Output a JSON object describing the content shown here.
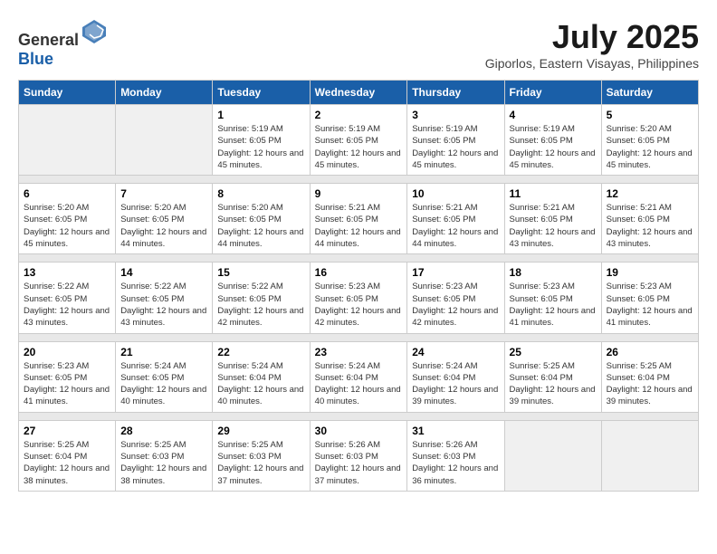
{
  "header": {
    "logo_general": "General",
    "logo_blue": "Blue",
    "month_year": "July 2025",
    "location": "Giporlos, Eastern Visayas, Philippines"
  },
  "calendar": {
    "days_of_week": [
      "Sunday",
      "Monday",
      "Tuesday",
      "Wednesday",
      "Thursday",
      "Friday",
      "Saturday"
    ],
    "weeks": [
      [
        {
          "day": "",
          "sunrise": "",
          "sunset": "",
          "daylight": ""
        },
        {
          "day": "",
          "sunrise": "",
          "sunset": "",
          "daylight": ""
        },
        {
          "day": "1",
          "sunrise": "Sunrise: 5:19 AM",
          "sunset": "Sunset: 6:05 PM",
          "daylight": "Daylight: 12 hours and 45 minutes."
        },
        {
          "day": "2",
          "sunrise": "Sunrise: 5:19 AM",
          "sunset": "Sunset: 6:05 PM",
          "daylight": "Daylight: 12 hours and 45 minutes."
        },
        {
          "day": "3",
          "sunrise": "Sunrise: 5:19 AM",
          "sunset": "Sunset: 6:05 PM",
          "daylight": "Daylight: 12 hours and 45 minutes."
        },
        {
          "day": "4",
          "sunrise": "Sunrise: 5:19 AM",
          "sunset": "Sunset: 6:05 PM",
          "daylight": "Daylight: 12 hours and 45 minutes."
        },
        {
          "day": "5",
          "sunrise": "Sunrise: 5:20 AM",
          "sunset": "Sunset: 6:05 PM",
          "daylight": "Daylight: 12 hours and 45 minutes."
        }
      ],
      [
        {
          "day": "6",
          "sunrise": "Sunrise: 5:20 AM",
          "sunset": "Sunset: 6:05 PM",
          "daylight": "Daylight: 12 hours and 45 minutes."
        },
        {
          "day": "7",
          "sunrise": "Sunrise: 5:20 AM",
          "sunset": "Sunset: 6:05 PM",
          "daylight": "Daylight: 12 hours and 44 minutes."
        },
        {
          "day": "8",
          "sunrise": "Sunrise: 5:20 AM",
          "sunset": "Sunset: 6:05 PM",
          "daylight": "Daylight: 12 hours and 44 minutes."
        },
        {
          "day": "9",
          "sunrise": "Sunrise: 5:21 AM",
          "sunset": "Sunset: 6:05 PM",
          "daylight": "Daylight: 12 hours and 44 minutes."
        },
        {
          "day": "10",
          "sunrise": "Sunrise: 5:21 AM",
          "sunset": "Sunset: 6:05 PM",
          "daylight": "Daylight: 12 hours and 44 minutes."
        },
        {
          "day": "11",
          "sunrise": "Sunrise: 5:21 AM",
          "sunset": "Sunset: 6:05 PM",
          "daylight": "Daylight: 12 hours and 43 minutes."
        },
        {
          "day": "12",
          "sunrise": "Sunrise: 5:21 AM",
          "sunset": "Sunset: 6:05 PM",
          "daylight": "Daylight: 12 hours and 43 minutes."
        }
      ],
      [
        {
          "day": "13",
          "sunrise": "Sunrise: 5:22 AM",
          "sunset": "Sunset: 6:05 PM",
          "daylight": "Daylight: 12 hours and 43 minutes."
        },
        {
          "day": "14",
          "sunrise": "Sunrise: 5:22 AM",
          "sunset": "Sunset: 6:05 PM",
          "daylight": "Daylight: 12 hours and 43 minutes."
        },
        {
          "day": "15",
          "sunrise": "Sunrise: 5:22 AM",
          "sunset": "Sunset: 6:05 PM",
          "daylight": "Daylight: 12 hours and 42 minutes."
        },
        {
          "day": "16",
          "sunrise": "Sunrise: 5:23 AM",
          "sunset": "Sunset: 6:05 PM",
          "daylight": "Daylight: 12 hours and 42 minutes."
        },
        {
          "day": "17",
          "sunrise": "Sunrise: 5:23 AM",
          "sunset": "Sunset: 6:05 PM",
          "daylight": "Daylight: 12 hours and 42 minutes."
        },
        {
          "day": "18",
          "sunrise": "Sunrise: 5:23 AM",
          "sunset": "Sunset: 6:05 PM",
          "daylight": "Daylight: 12 hours and 41 minutes."
        },
        {
          "day": "19",
          "sunrise": "Sunrise: 5:23 AM",
          "sunset": "Sunset: 6:05 PM",
          "daylight": "Daylight: 12 hours and 41 minutes."
        }
      ],
      [
        {
          "day": "20",
          "sunrise": "Sunrise: 5:23 AM",
          "sunset": "Sunset: 6:05 PM",
          "daylight": "Daylight: 12 hours and 41 minutes."
        },
        {
          "day": "21",
          "sunrise": "Sunrise: 5:24 AM",
          "sunset": "Sunset: 6:05 PM",
          "daylight": "Daylight: 12 hours and 40 minutes."
        },
        {
          "day": "22",
          "sunrise": "Sunrise: 5:24 AM",
          "sunset": "Sunset: 6:04 PM",
          "daylight": "Daylight: 12 hours and 40 minutes."
        },
        {
          "day": "23",
          "sunrise": "Sunrise: 5:24 AM",
          "sunset": "Sunset: 6:04 PM",
          "daylight": "Daylight: 12 hours and 40 minutes."
        },
        {
          "day": "24",
          "sunrise": "Sunrise: 5:24 AM",
          "sunset": "Sunset: 6:04 PM",
          "daylight": "Daylight: 12 hours and 39 minutes."
        },
        {
          "day": "25",
          "sunrise": "Sunrise: 5:25 AM",
          "sunset": "Sunset: 6:04 PM",
          "daylight": "Daylight: 12 hours and 39 minutes."
        },
        {
          "day": "26",
          "sunrise": "Sunrise: 5:25 AM",
          "sunset": "Sunset: 6:04 PM",
          "daylight": "Daylight: 12 hours and 39 minutes."
        }
      ],
      [
        {
          "day": "27",
          "sunrise": "Sunrise: 5:25 AM",
          "sunset": "Sunset: 6:04 PM",
          "daylight": "Daylight: 12 hours and 38 minutes."
        },
        {
          "day": "28",
          "sunrise": "Sunrise: 5:25 AM",
          "sunset": "Sunset: 6:03 PM",
          "daylight": "Daylight: 12 hours and 38 minutes."
        },
        {
          "day": "29",
          "sunrise": "Sunrise: 5:25 AM",
          "sunset": "Sunset: 6:03 PM",
          "daylight": "Daylight: 12 hours and 37 minutes."
        },
        {
          "day": "30",
          "sunrise": "Sunrise: 5:26 AM",
          "sunset": "Sunset: 6:03 PM",
          "daylight": "Daylight: 12 hours and 37 minutes."
        },
        {
          "day": "31",
          "sunrise": "Sunrise: 5:26 AM",
          "sunset": "Sunset: 6:03 PM",
          "daylight": "Daylight: 12 hours and 36 minutes."
        },
        {
          "day": "",
          "sunrise": "",
          "sunset": "",
          "daylight": ""
        },
        {
          "day": "",
          "sunrise": "",
          "sunset": "",
          "daylight": ""
        }
      ]
    ]
  }
}
